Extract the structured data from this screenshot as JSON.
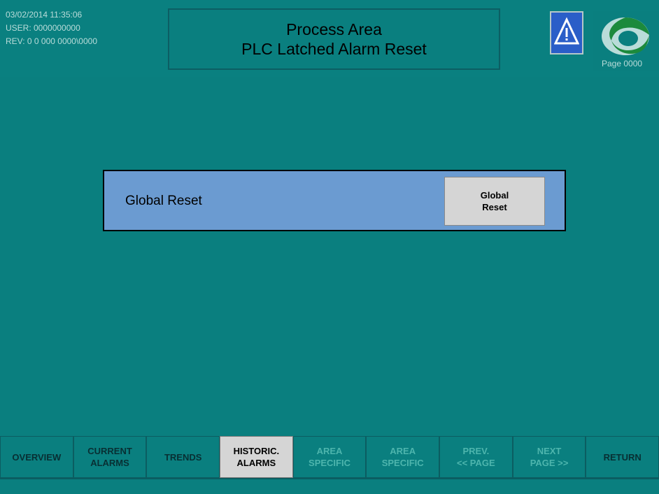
{
  "header": {
    "datetime": "03/02/2014 11:35:06",
    "user": "USER:   0000000000",
    "rev": "REV: 0 0 000 0000\\0000",
    "title_line1": "Process Area",
    "title_line2": "PLC Latched Alarm Reset",
    "page": "Page 0000"
  },
  "icons": {
    "alarm": "warning-triangle-icon",
    "logo": "company-logo-icon"
  },
  "panel": {
    "label": "Global Reset",
    "button_label": "Global\nReset"
  },
  "nav": {
    "items": [
      {
        "label": "OVERVIEW",
        "state": "normal"
      },
      {
        "label": "CURRENT\nALARMS",
        "state": "normal"
      },
      {
        "label": "TRENDS",
        "state": "normal"
      },
      {
        "label": "HISTORIC.\nALARMS",
        "state": "active"
      },
      {
        "label": "AREA\nSPECIFIC",
        "state": "disabled"
      },
      {
        "label": "AREA\nSPECIFIC",
        "state": "disabled"
      },
      {
        "label": "PREV.\n<< PAGE",
        "state": "disabled"
      },
      {
        "label": "NEXT\nPAGE >>",
        "state": "disabled"
      },
      {
        "label": "RETURN",
        "state": "normal"
      }
    ]
  },
  "colors": {
    "background": "#0a7f7f",
    "panel": "#6b9bd1",
    "button": "#d5d5d5",
    "alarm_icon_bg": "#2a5ec8"
  }
}
